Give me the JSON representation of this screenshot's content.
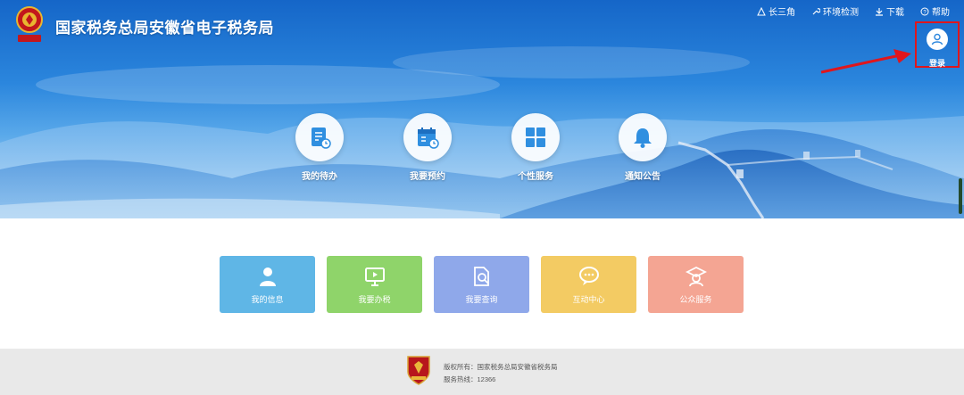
{
  "header": {
    "site_title": "国家税务总局安徽省电子税务局",
    "top_links": [
      {
        "icon": "triangle-network-icon",
        "label": "长三角"
      },
      {
        "icon": "wrench-icon",
        "label": "环境检测"
      },
      {
        "icon": "download-icon",
        "label": "下载"
      },
      {
        "icon": "question-icon",
        "label": "帮助"
      }
    ],
    "login_label": "登录"
  },
  "quick_entries": [
    {
      "icon": "todo-list-icon",
      "label": "我的待办"
    },
    {
      "icon": "calendar-icon",
      "label": "我要预约"
    },
    {
      "icon": "grid-icon",
      "label": "个性服务"
    },
    {
      "icon": "bell-icon",
      "label": "通知公告"
    }
  ],
  "service_tiles": [
    {
      "icon": "user-icon",
      "label": "我的信息",
      "color": "#5fb6e6"
    },
    {
      "icon": "monitor-icon",
      "label": "我要办税",
      "color": "#8fd46a"
    },
    {
      "icon": "document-search-icon",
      "label": "我要查询",
      "color": "#8fa8ea"
    },
    {
      "icon": "chat-bubble-icon",
      "label": "互动中心",
      "color": "#f3cb63"
    },
    {
      "icon": "graduate-icon",
      "label": "公众服务",
      "color": "#f4a593"
    }
  ],
  "footer": {
    "copyright": "版权所有：国家税务总局安徽省税务局",
    "hotline": "服务热线：12366"
  },
  "colors": {
    "highlight_red": "#e0161c",
    "footer_bg": "#e9e9e9"
  }
}
